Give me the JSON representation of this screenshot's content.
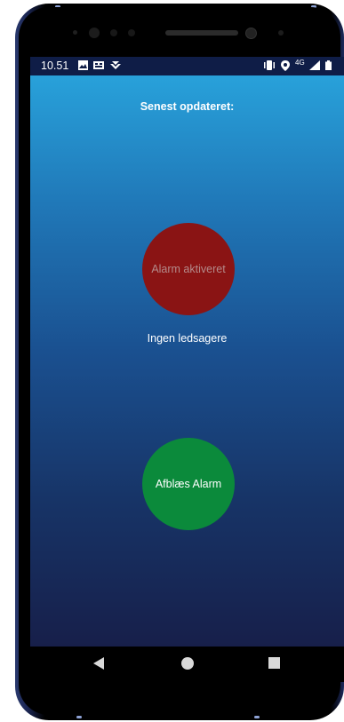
{
  "status_bar": {
    "time": "10.51",
    "network": "4G",
    "icons": [
      "image-icon",
      "sim-icon",
      "arrow-icon",
      "vibrate-icon",
      "location-icon",
      "signal-icon",
      "battery-icon"
    ]
  },
  "main": {
    "title": "Senest opdateret:",
    "alarm_status_label": "Alarm aktiveret",
    "companions_text": "Ingen ledsagere",
    "cancel_button_label": "Afblæs Alarm"
  },
  "nav_bar": {
    "icons": [
      "back-icon",
      "home-icon",
      "recents-icon"
    ]
  },
  "colors": {
    "alarm_red": "#8a1414",
    "cancel_green": "#0b8a3b",
    "gradient_top": "#29a7df",
    "gradient_bottom": "#171f4a"
  }
}
